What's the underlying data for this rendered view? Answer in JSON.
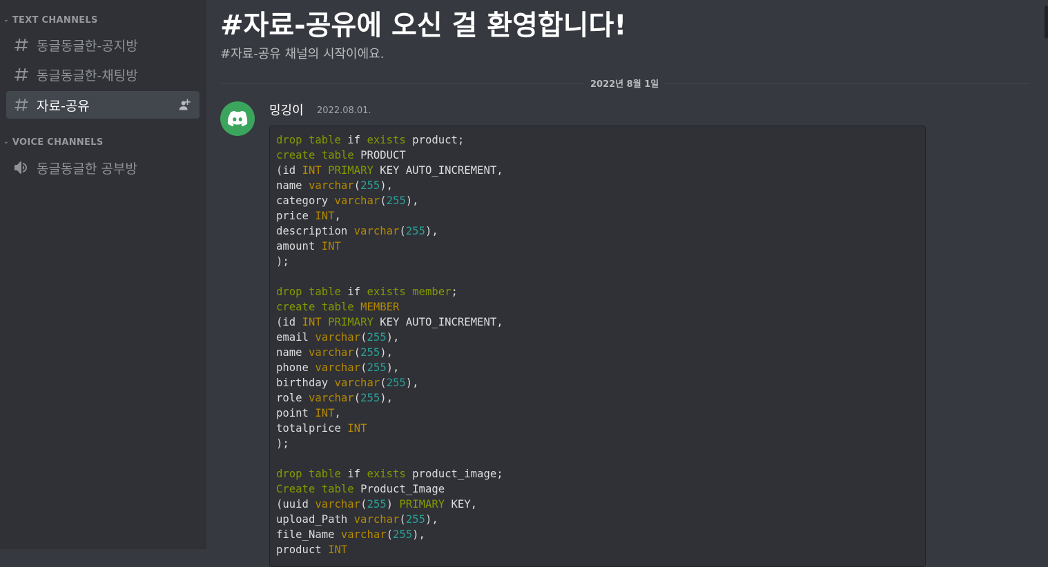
{
  "sidebar": {
    "text_category": "TEXT CHANNELS",
    "voice_category": "VOICE CHANNELS",
    "text_channels": [
      {
        "name": "동글동글한-공지방"
      },
      {
        "name": "동글동글한-채팅방"
      },
      {
        "name": "자료-공유"
      }
    ],
    "voice_channels": [
      {
        "name": "동글동글한 공부방"
      }
    ]
  },
  "main": {
    "welcome_title": "#자료-공유에 오신 걸 환영합니다!",
    "welcome_subtitle": "#자료-공유 채널의 시작이에요.",
    "date_divider": "2022년 8월 1일",
    "message": {
      "author": "밍깅이",
      "timestamp": "2022.08.01.",
      "code_lines": [
        [
          [
            "kw",
            "drop table "
          ],
          [
            "plain",
            "if "
          ],
          [
            "kw",
            "exists "
          ],
          [
            "plain",
            "product;"
          ]
        ],
        [
          [
            "kw",
            "create table "
          ],
          [
            "plain",
            "PRODUCT"
          ]
        ],
        [
          [
            "plain",
            "(id "
          ],
          [
            "type",
            "INT "
          ],
          [
            "kw",
            "PRIMARY "
          ],
          [
            "plain",
            "KEY AUTO_INCREMENT,"
          ]
        ],
        [
          [
            "plain",
            "name "
          ],
          [
            "type",
            "varchar"
          ],
          [
            "plain",
            "("
          ],
          [
            "num",
            "255"
          ],
          [
            "plain",
            "),"
          ]
        ],
        [
          [
            "plain",
            "category "
          ],
          [
            "type",
            "varchar"
          ],
          [
            "plain",
            "("
          ],
          [
            "num",
            "255"
          ],
          [
            "plain",
            "),"
          ]
        ],
        [
          [
            "plain",
            "price "
          ],
          [
            "type",
            "INT"
          ],
          [
            "plain",
            ","
          ]
        ],
        [
          [
            "plain",
            "description "
          ],
          [
            "type",
            "varchar"
          ],
          [
            "plain",
            "("
          ],
          [
            "num",
            "255"
          ],
          [
            "plain",
            "),"
          ]
        ],
        [
          [
            "plain",
            "amount "
          ],
          [
            "type",
            "INT"
          ]
        ],
        [
          [
            "plain",
            ");"
          ]
        ],
        [],
        [
          [
            "kw",
            "drop table "
          ],
          [
            "plain",
            "if "
          ],
          [
            "kw",
            "exists "
          ],
          [
            "kw",
            "member"
          ],
          [
            "plain",
            ";"
          ]
        ],
        [
          [
            "kw",
            "create table "
          ],
          [
            "type",
            "MEMBER"
          ]
        ],
        [
          [
            "plain",
            "(id "
          ],
          [
            "type",
            "INT "
          ],
          [
            "kw",
            "PRIMARY "
          ],
          [
            "plain",
            "KEY AUTO_INCREMENT,"
          ]
        ],
        [
          [
            "plain",
            "email "
          ],
          [
            "type",
            "varchar"
          ],
          [
            "plain",
            "("
          ],
          [
            "num",
            "255"
          ],
          [
            "plain",
            "),"
          ]
        ],
        [
          [
            "plain",
            "name "
          ],
          [
            "type",
            "varchar"
          ],
          [
            "plain",
            "("
          ],
          [
            "num",
            "255"
          ],
          [
            "plain",
            "),"
          ]
        ],
        [
          [
            "plain",
            "phone "
          ],
          [
            "type",
            "varchar"
          ],
          [
            "plain",
            "("
          ],
          [
            "num",
            "255"
          ],
          [
            "plain",
            "),"
          ]
        ],
        [
          [
            "plain",
            "birthday "
          ],
          [
            "type",
            "varchar"
          ],
          [
            "plain",
            "("
          ],
          [
            "num",
            "255"
          ],
          [
            "plain",
            "),"
          ]
        ],
        [
          [
            "plain",
            "role "
          ],
          [
            "type",
            "varchar"
          ],
          [
            "plain",
            "("
          ],
          [
            "num",
            "255"
          ],
          [
            "plain",
            "),"
          ]
        ],
        [
          [
            "plain",
            "point "
          ],
          [
            "type",
            "INT"
          ],
          [
            "plain",
            ","
          ]
        ],
        [
          [
            "plain",
            "totalprice "
          ],
          [
            "type",
            "INT"
          ]
        ],
        [
          [
            "plain",
            ");"
          ]
        ],
        [],
        [
          [
            "kw",
            "drop table "
          ],
          [
            "plain",
            "if "
          ],
          [
            "kw",
            "exists "
          ],
          [
            "plain",
            "product_image;"
          ]
        ],
        [
          [
            "kw",
            "Create table "
          ],
          [
            "plain",
            "Product_Image"
          ]
        ],
        [
          [
            "plain",
            "(uuid "
          ],
          [
            "type",
            "varchar"
          ],
          [
            "plain",
            "("
          ],
          [
            "num",
            "255"
          ],
          [
            "plain",
            ") "
          ],
          [
            "kw",
            "PRIMARY "
          ],
          [
            "plain",
            "KEY,"
          ]
        ],
        [
          [
            "plain",
            "upload_Path "
          ],
          [
            "type",
            "varchar"
          ],
          [
            "plain",
            "("
          ],
          [
            "num",
            "255"
          ],
          [
            "plain",
            "),"
          ]
        ],
        [
          [
            "plain",
            "file_Name "
          ],
          [
            "type",
            "varchar"
          ],
          [
            "plain",
            "("
          ],
          [
            "num",
            "255"
          ],
          [
            "plain",
            "),"
          ]
        ],
        [
          [
            "plain",
            "product "
          ],
          [
            "type",
            "INT"
          ]
        ]
      ]
    }
  },
  "colors": {
    "app_bg": "#36393f",
    "sidebar_bg": "#2f3136",
    "selected_channel_bg": "#42464d",
    "avatar_green": "#3ba55d",
    "code_keyword": "#859900",
    "code_type": "#b58900",
    "code_number": "#2aa198"
  },
  "icons": {
    "channel": "hash-icon",
    "voice": "speaker-icon",
    "invite": "add-user-icon",
    "avatar": "discord-logo-icon",
    "collapse": "chevron-down-icon"
  }
}
